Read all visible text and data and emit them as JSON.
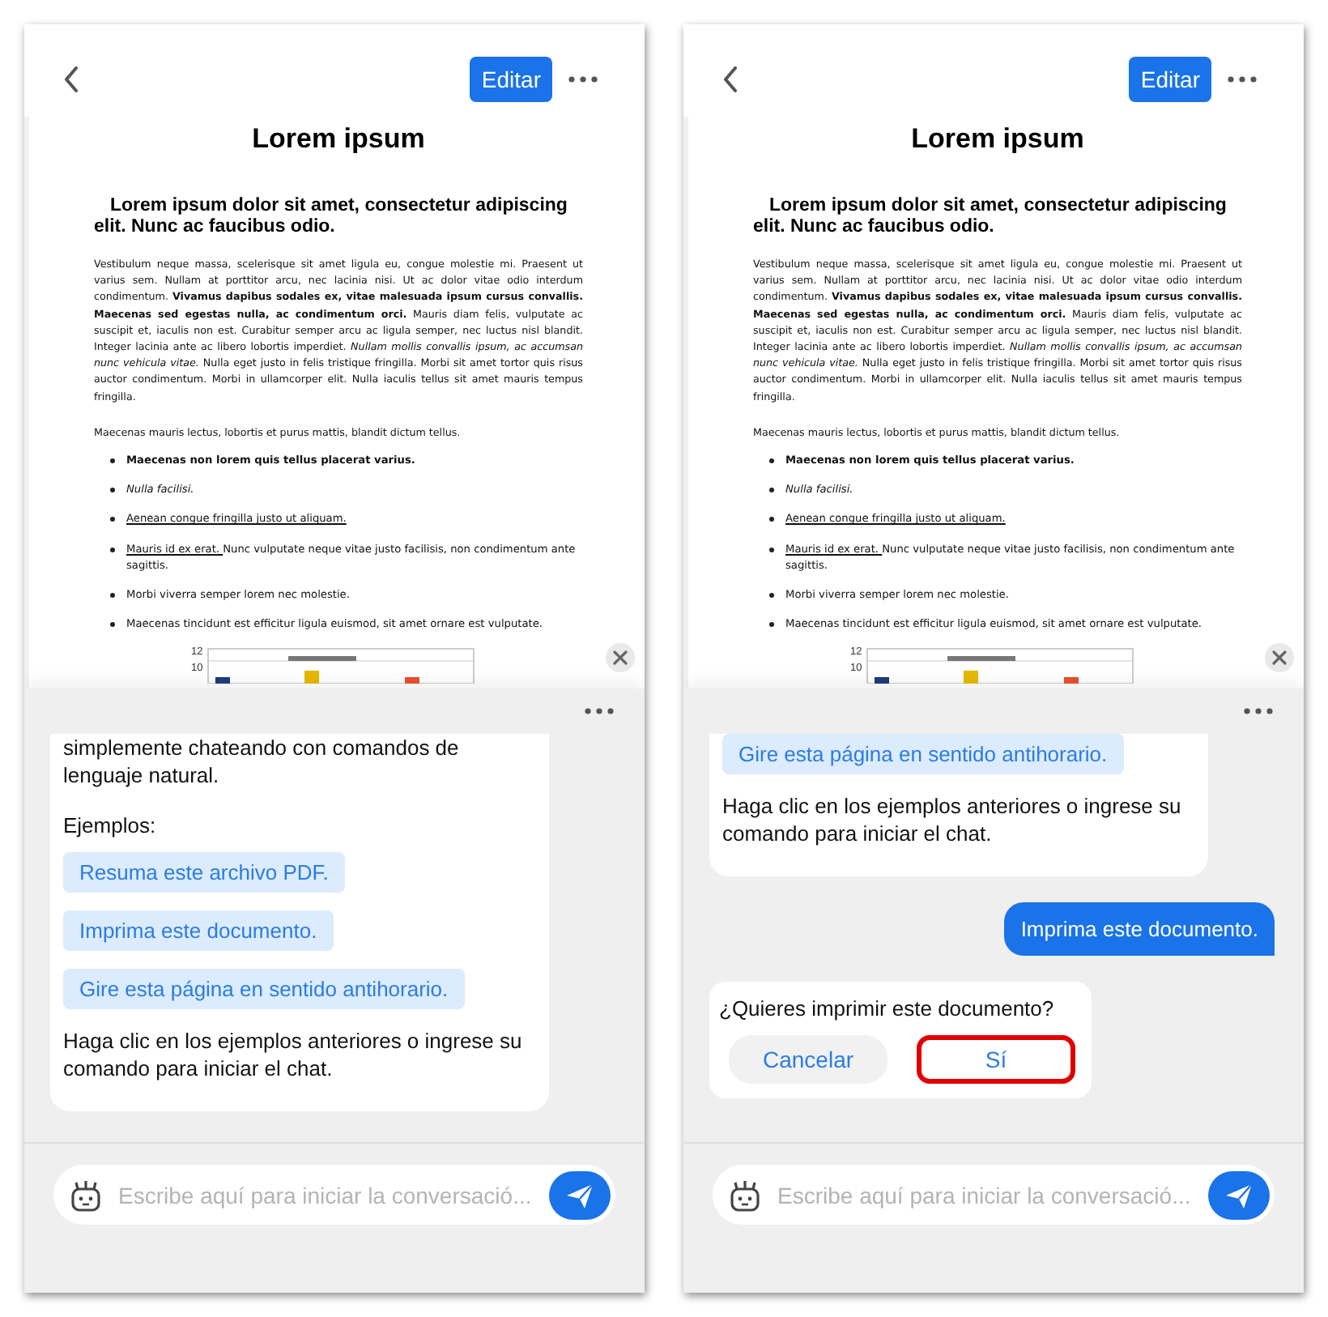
{
  "phones": [
    {
      "header": {
        "edit_label": "Editar"
      },
      "document": {
        "title": "Lorem ipsum",
        "heading": "Lorem ipsum dolor sit amet, consectetur adipiscing elit. Nunc ac faucibus odio.",
        "paragraphs": [
          "Vestibulum neque massa, scelerisque sit amet ligula eu, congue molestie mi. Praesent ut varius sem. Nullam at porttitor arcu, nec lacinia nisi. Ut ac dolor vitae odio interdum condimentum. **Vivamus dapibus sodales ex, vitae malesuada ipsum cursus convallis. Maecenas sed egestas nulla, ac condimentum orci.** Mauris diam felis, vulputate ac suscipit et, iaculis non est. Curabitur semper arcu ac ligula semper, nec luctus nisl blandit. Integer lacinia ante ac libero lobortis imperdiet. *Nullam mollis convallis ipsum, ac accumsan nunc vehicula vitae.* Nulla eget justo in felis tristique fringilla. Morbi sit amet tortor quis risus auctor condimentum. Morbi in ullamcorper elit. Nulla iaculis tellus sit amet mauris tempus fringilla.",
          "Maecenas mauris lectus, lobortis et purus mattis, blandit dictum tellus."
        ],
        "list": [
          {
            "kind": "plain",
            "text": "**Maecenas non lorem quis tellus placerat varius.**"
          },
          {
            "kind": "plain",
            "text": "*Nulla facilisi.*"
          },
          {
            "kind": "underlined",
            "text": "Aenean congue fringilla justo ut aliquam. "
          },
          {
            "kind": "underlined_lead",
            "lead": "Mauris id ex erat. ",
            "text": "Nunc vulputate neque vitae justo facilisis, non condimentum ante sagittis."
          },
          {
            "kind": "plain",
            "text": "Morbi viverra semper lorem nec molestie."
          },
          {
            "kind": "plain",
            "text": "Maecenas tincidunt est efficitur ligula euismod, sit amet ornare est vulputate."
          }
        ],
        "chart": {
          "ticks": [
            "12",
            "10"
          ]
        }
      },
      "chat": {
        "messages": [
          {
            "kind": "bot",
            "blocks": [
              {
                "kind": "text",
                "text": "simplemente chateando con comandos de lenguaje natural."
              },
              {
                "kind": "text",
                "text": "Ejemplos:"
              },
              {
                "kind": "chip",
                "text": "Resuma este archivo PDF."
              },
              {
                "kind": "chip",
                "text": "Imprima este documento."
              },
              {
                "kind": "chip",
                "text": "Gire esta página en sentido antihorario."
              },
              {
                "kind": "text",
                "text": "Haga clic en los ejemplos anteriores o ingrese su comando para iniciar el chat."
              }
            ]
          }
        ]
      },
      "input": {
        "placeholder": "Escribe aquí para iniciar la conversació..."
      }
    },
    {
      "header": {
        "edit_label": "Editar"
      },
      "document": {
        "title": "Lorem ipsum",
        "heading": "Lorem ipsum dolor sit amet, consectetur adipiscing elit. Nunc ac faucibus odio.",
        "paragraphs": [
          "Vestibulum neque massa, scelerisque sit amet ligula eu, congue molestie mi. Praesent ut varius sem. Nullam at porttitor arcu, nec lacinia nisi. Ut ac dolor vitae odio interdum condimentum. **Vivamus dapibus sodales ex, vitae malesuada ipsum cursus convallis. Maecenas sed egestas nulla, ac condimentum orci.** Mauris diam felis, vulputate ac suscipit et, iaculis non est. Curabitur semper arcu ac ligula semper, nec luctus nisl blandit. Integer lacinia ante ac libero lobortis imperdiet. *Nullam mollis convallis ipsum, ac accumsan nunc vehicula vitae.* Nulla eget justo in felis tristique fringilla. Morbi sit amet tortor quis risus auctor condimentum. Morbi in ullamcorper elit. Nulla iaculis tellus sit amet mauris tempus fringilla.",
          "Maecenas mauris lectus, lobortis et purus mattis, blandit dictum tellus."
        ],
        "list": [
          {
            "kind": "plain",
            "text": "**Maecenas non lorem quis tellus placerat varius.**"
          },
          {
            "kind": "plain",
            "text": "*Nulla facilisi.*"
          },
          {
            "kind": "underlined",
            "text": "Aenean congue fringilla justo ut aliquam. "
          },
          {
            "kind": "underlined_lead",
            "lead": "Mauris id ex erat. ",
            "text": "Nunc vulputate neque vitae justo facilisis, non condimentum ante sagittis."
          },
          {
            "kind": "plain",
            "text": "Morbi viverra semper lorem nec molestie."
          },
          {
            "kind": "plain",
            "text": "Maecenas tincidunt est efficitur ligula euismod, sit amet ornare est vulputate."
          }
        ],
        "chart": {
          "ticks": [
            "12",
            "10"
          ]
        }
      },
      "chat": {
        "messages": [
          {
            "kind": "bot",
            "blocks": [
              {
                "kind": "chip",
                "text": "Gire esta página en sentido antihorario."
              },
              {
                "kind": "text",
                "text": "Haga clic en los ejemplos anteriores o ingrese su comando para iniciar el chat."
              }
            ]
          },
          {
            "kind": "user",
            "text": "Imprima este documento."
          },
          {
            "kind": "confirm",
            "question": "¿Quieres imprimir este documento?",
            "buttons": [
              {
                "label": "Cancelar",
                "highlighted": false
              },
              {
                "label": "Sí",
                "highlighted": true
              }
            ]
          }
        ]
      },
      "input": {
        "placeholder": "Escribe aquí para iniciar la conversació..."
      }
    }
  ]
}
